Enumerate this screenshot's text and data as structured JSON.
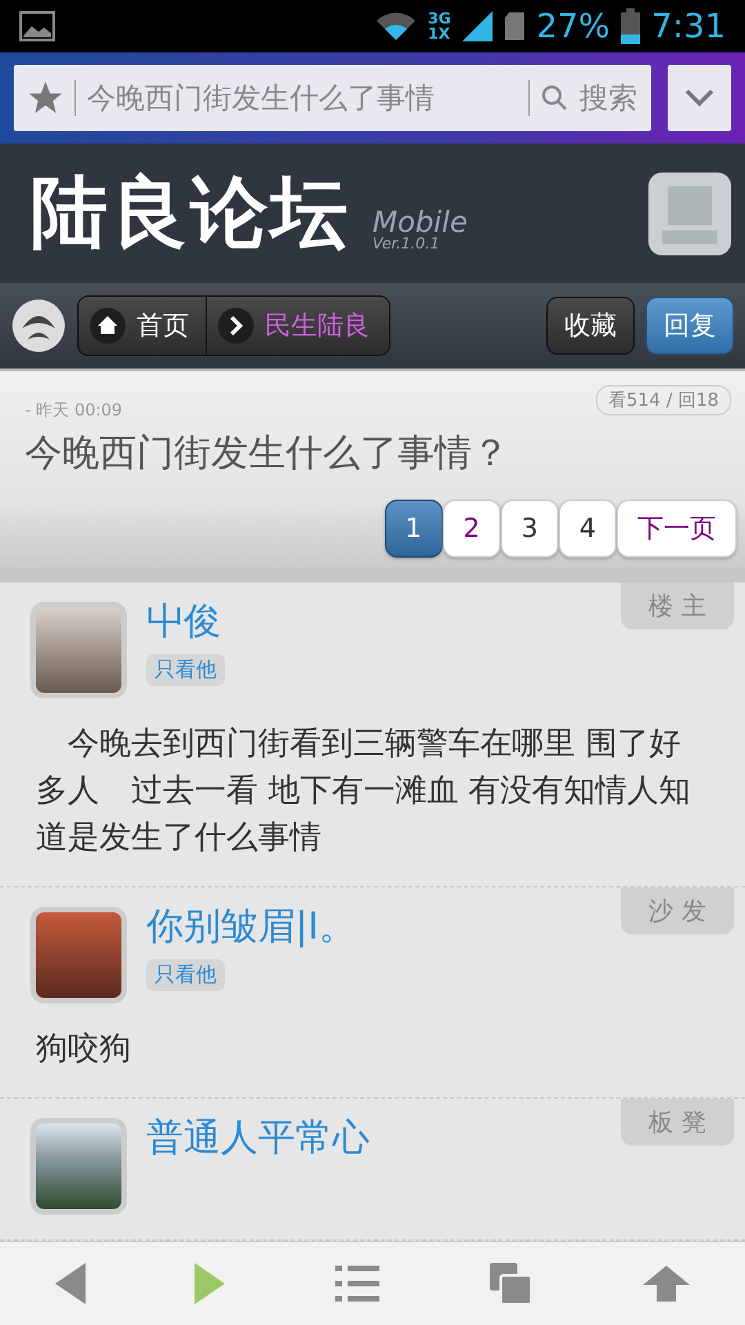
{
  "status_bar": {
    "network": "3G",
    "network_2": "1X",
    "battery": "27%",
    "time": "7:31"
  },
  "browser_bar": {
    "address": "今晚西门街发生什么了事情",
    "search_label": "搜索"
  },
  "header": {
    "title": "陆良论坛",
    "subtitle": "Mobile",
    "version": "Ver.1.0.1"
  },
  "nav": {
    "breadcrumbs": [
      {
        "label": "首页",
        "kind": "home",
        "visited": false
      },
      {
        "label": "民生陆良",
        "kind": "section",
        "visited": true
      }
    ],
    "buttons": [
      {
        "label": "收藏",
        "primary": false
      },
      {
        "label": "回复",
        "primary": true
      }
    ]
  },
  "thread": {
    "time": "- 昨天 00:09",
    "stats": "看514 / 回18",
    "title": "今晚西门街发生什么了事情？",
    "pages": [
      {
        "label": "1",
        "selected": true,
        "visited": false
      },
      {
        "label": "2",
        "selected": false,
        "visited": true
      },
      {
        "label": "3",
        "selected": false,
        "visited": false
      },
      {
        "label": "4",
        "selected": false,
        "visited": false
      },
      {
        "label": "下一页",
        "selected": false,
        "visited": true
      }
    ]
  },
  "posts": [
    {
      "author": "屮俊",
      "filter": "只看他",
      "floor": "楼 主",
      "content": "今晚去到西门街看到三辆警车在哪里 围了好多人　过去一看 地下有一滩血 有没有知情人知道是发生了什么事情",
      "indent": true
    },
    {
      "author": "你别皱眉|I。",
      "filter": "只看他",
      "floor": "沙 发",
      "content": "狗咬狗",
      "indent": false
    },
    {
      "author": "普通人平常心",
      "floor": "板 凳"
    }
  ]
}
